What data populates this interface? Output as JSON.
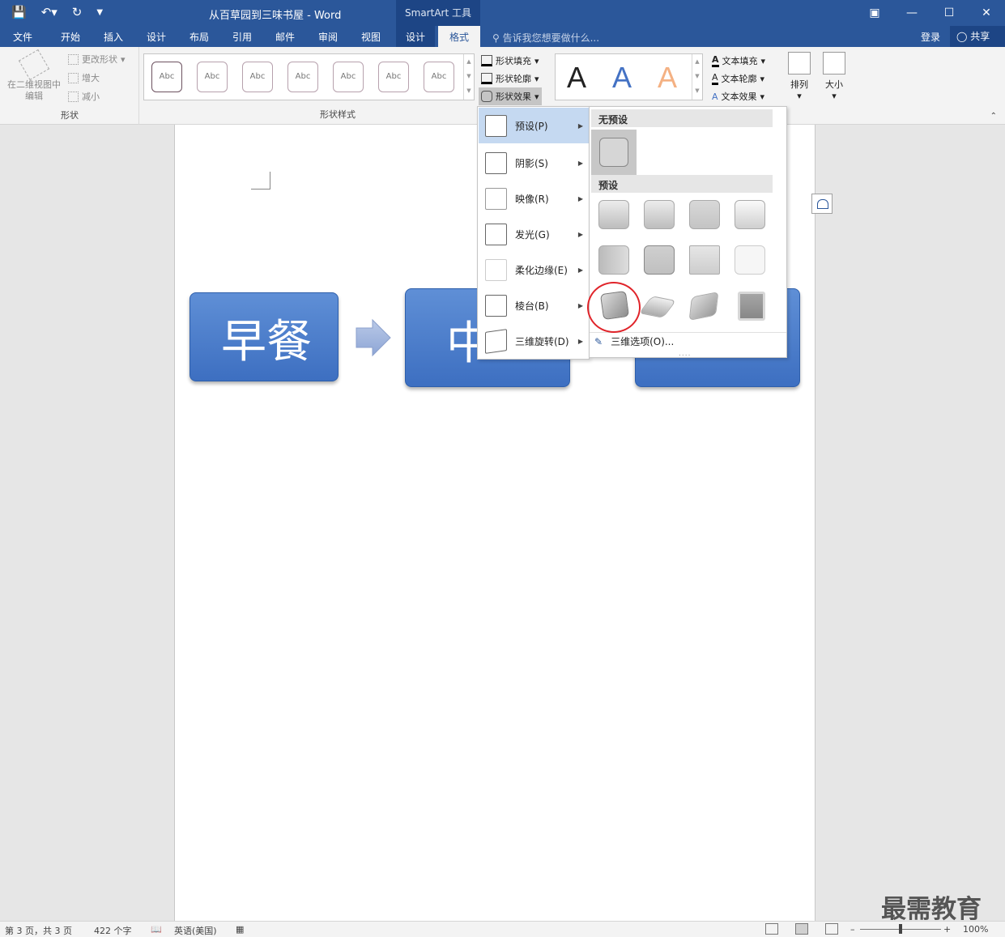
{
  "titlebar": {
    "doc_title": "从百草园到三味书屋 - Word",
    "context_tool": "SmartArt 工具",
    "qat_icons": [
      "save-icon",
      "undo-icon",
      "redo-icon",
      "customize-icon"
    ],
    "window_controls": [
      "ribbon-display-icon",
      "minimize-icon",
      "maximize-icon",
      "close-icon"
    ]
  },
  "tabs": {
    "file": "文件",
    "home": "开始",
    "insert": "插入",
    "design1": "设计",
    "layout": "布局",
    "references": "引用",
    "mailings": "邮件",
    "review": "审阅",
    "view": "视图",
    "sa_design": "设计",
    "sa_format": "格式",
    "tellme": "告诉我您想要做什么...",
    "login": "登录",
    "share": "共享"
  },
  "ribbon": {
    "shapes_group": {
      "edit_2d": "在二维视图中编辑",
      "change_shape": "更改形状",
      "larger": "增大",
      "smaller": "减小",
      "label": "形状"
    },
    "shape_styles": {
      "label": "形状样式",
      "items": [
        "Abc",
        "Abc",
        "Abc",
        "Abc",
        "Abc",
        "Abc",
        "Abc"
      ],
      "fill": "形状填充",
      "outline": "形状轮廓",
      "effects": "形状效果"
    },
    "wordart": {
      "samples": [
        "A",
        "A",
        "A"
      ],
      "sample_colors": [
        "#000000",
        "#4472c4",
        "#f4b183"
      ],
      "text_fill": "文本填充",
      "text_outline": "文本轮廓",
      "text_effects": "文本效果"
    },
    "arrange": "排列",
    "size": "大小"
  },
  "smartart": {
    "box1": "早餐",
    "box2": "中",
    "box_color": "#4472c4"
  },
  "effects_menu": {
    "preset": "预设(P)",
    "shadow": "阴影(S)",
    "reflection": "映像(R)",
    "glow": "发光(G)",
    "soft_edges": "柔化边缘(E)",
    "bevel": "棱台(B)",
    "rotation": "三维旋转(D)"
  },
  "preset_panel": {
    "no_preset_header": "无预设",
    "preset_header": "预设",
    "three_d_options": "三维选项(O)...",
    "preset_count": 12
  },
  "statusbar": {
    "page": "第 3 页，共 3 页",
    "words": "422 个字",
    "language": "英语(美国)",
    "zoom": "100%"
  },
  "watermark": "最需教育"
}
